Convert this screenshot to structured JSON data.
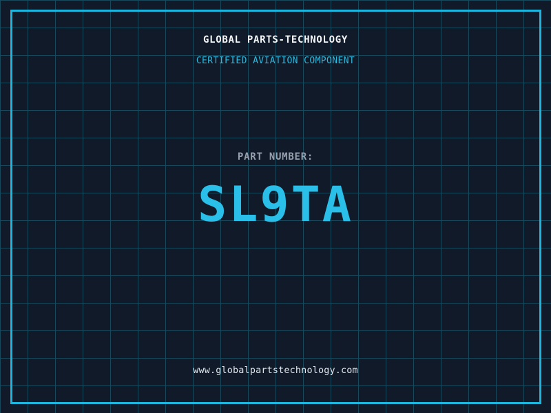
{
  "header": {
    "title": "GLOBAL PARTS-TECHNOLOGY",
    "subtitle": "CERTIFIED AVIATION COMPONENT"
  },
  "part": {
    "label": "PART NUMBER:",
    "number": "SL9TA"
  },
  "footer": {
    "website": "www.globalpartstechnology.com"
  },
  "colors": {
    "background": "#101a29",
    "grid_line": "#17485c",
    "frame_accent": "#1cb5de",
    "title_text": "#f4f6f8",
    "subtitle_text": "#2fb9de",
    "part_label_text": "#97a1ae",
    "part_number_text": "#2abfe8",
    "website_text": "#e2e8ee"
  }
}
